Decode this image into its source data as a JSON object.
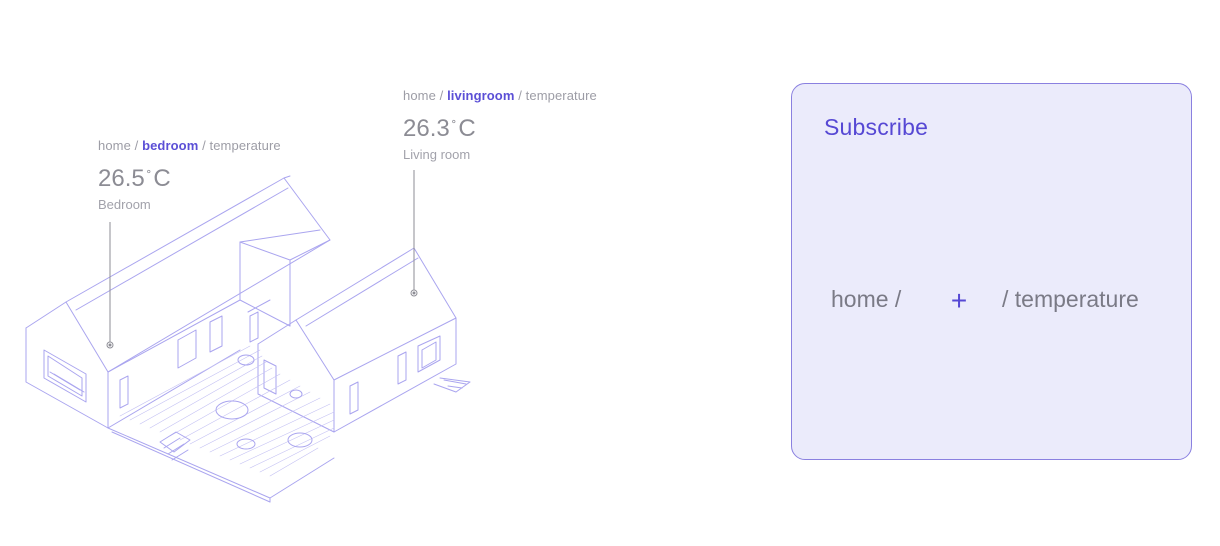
{
  "sensors": {
    "bedroom": {
      "topic_prefix": "home /",
      "topic_room": "bedroom",
      "topic_suffix": "/ temperature",
      "value": "26.5",
      "degree": "˚",
      "unit": "C",
      "label": "Bedroom"
    },
    "livingroom": {
      "topic_prefix": "home /",
      "topic_room": "livingroom",
      "topic_suffix": "/ temperature",
      "value": "26.3",
      "degree": "˚",
      "unit": "C",
      "label": "Living room"
    }
  },
  "subscribe": {
    "title": "Subscribe",
    "topic_prefix": "home /",
    "add_symbol": "+",
    "topic_suffix": "/ temperature"
  },
  "colors": {
    "accent": "#5648d4",
    "house_line": "#a9a4ef",
    "panel_bg": "#ebebfb",
    "panel_border": "#8a80e0"
  },
  "icons": {
    "add": "plus-icon",
    "sensor_marker": "sensor-dot-icon"
  }
}
